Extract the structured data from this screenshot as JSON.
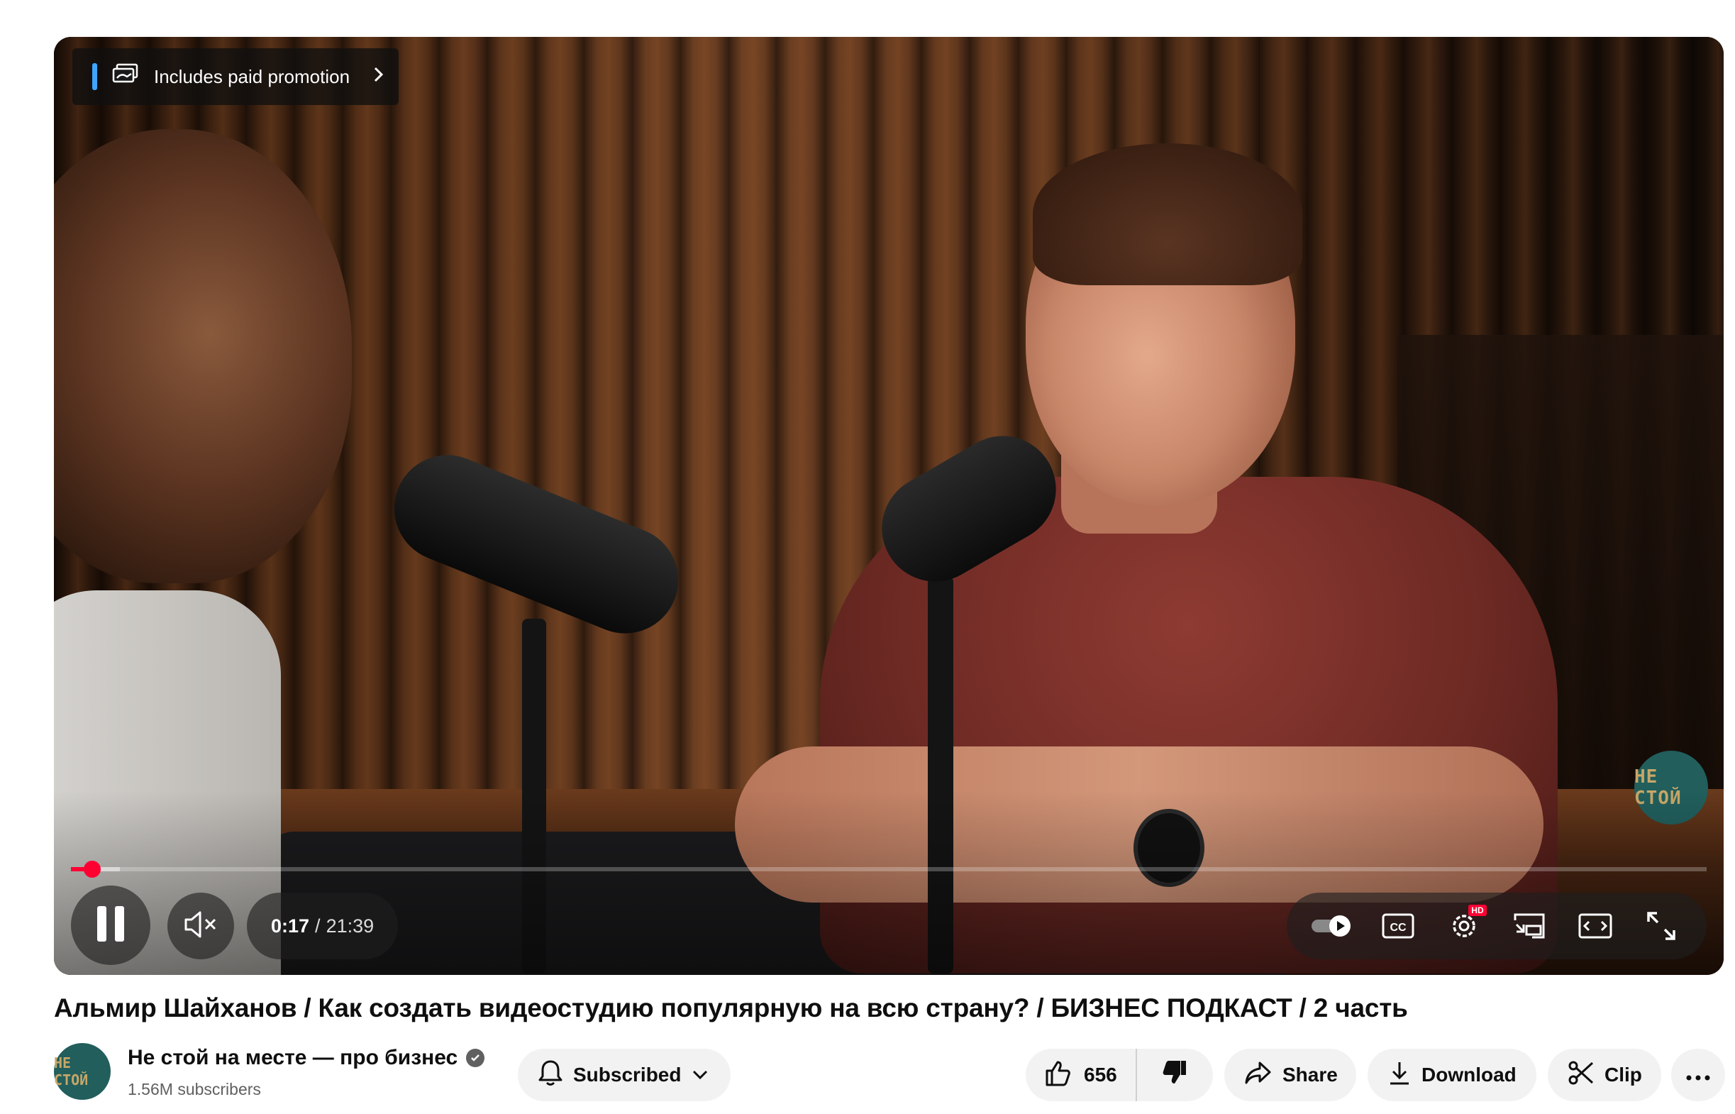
{
  "player": {
    "promo_label": "Includes paid promotion",
    "current_time": "0:17",
    "separator": "/",
    "duration": "21:39",
    "progress_fraction": 0.013,
    "loaded_fraction": 0.03,
    "watermark_text": "НЕ СТОЙ",
    "icons": {
      "promo": "paid-promotion-icon",
      "promo_arrow": "chevron-right-icon",
      "play": "pause-icon",
      "mute": "muted-speaker-icon",
      "autoplay": "autoplay-toggle-icon",
      "captions": "closed-captions-icon",
      "settings": "settings-gear-icon",
      "miniplayer": "miniplayer-icon",
      "theater": "theater-mode-icon",
      "fullscreen": "fullscreen-icon"
    },
    "hd_badge": "HD",
    "accent_color": "#ff0033"
  },
  "video": {
    "title": "Альмир Шайханов / Как создать видеостудию популярную на всю страну? / БИЗНЕС ПОДКАСТ / 2 часть"
  },
  "channel": {
    "avatar_text": "НЕ СТОЙ",
    "name": "Не стой на месте — про бизнес",
    "subscribers": "1.56M subscribers",
    "verified": true
  },
  "actions": {
    "subscribed_label": "Subscribed",
    "like_count": "656",
    "share_label": "Share",
    "download_label": "Download",
    "clip_label": "Clip"
  }
}
